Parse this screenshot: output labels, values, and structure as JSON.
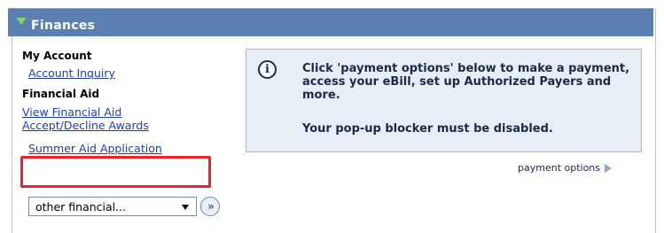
{
  "header": {
    "title": "Finances"
  },
  "left": {
    "my_account_label": "My Account",
    "account_inquiry": "Account Inquiry",
    "financial_aid_label": "Financial Aid",
    "view_financial_aid_line1": "View Financial Aid",
    "view_financial_aid_line2": "Accept/Decline Awards",
    "summer_aid": "Summer Aid Application",
    "dropdown_value": "other financial..."
  },
  "info": {
    "message": "Click 'payment options' below to make a payment, access your eBill, set up Authorized Payers and more.",
    "popup_note": "Your pop-up blocker must be disabled.",
    "icon": "info-icon"
  },
  "payment_options": "payment options",
  "colors": {
    "header_bg": "#5b7fb0",
    "link": "#1f3fa0",
    "highlight": "#e8262a",
    "info_bg": "#e8eef6"
  }
}
